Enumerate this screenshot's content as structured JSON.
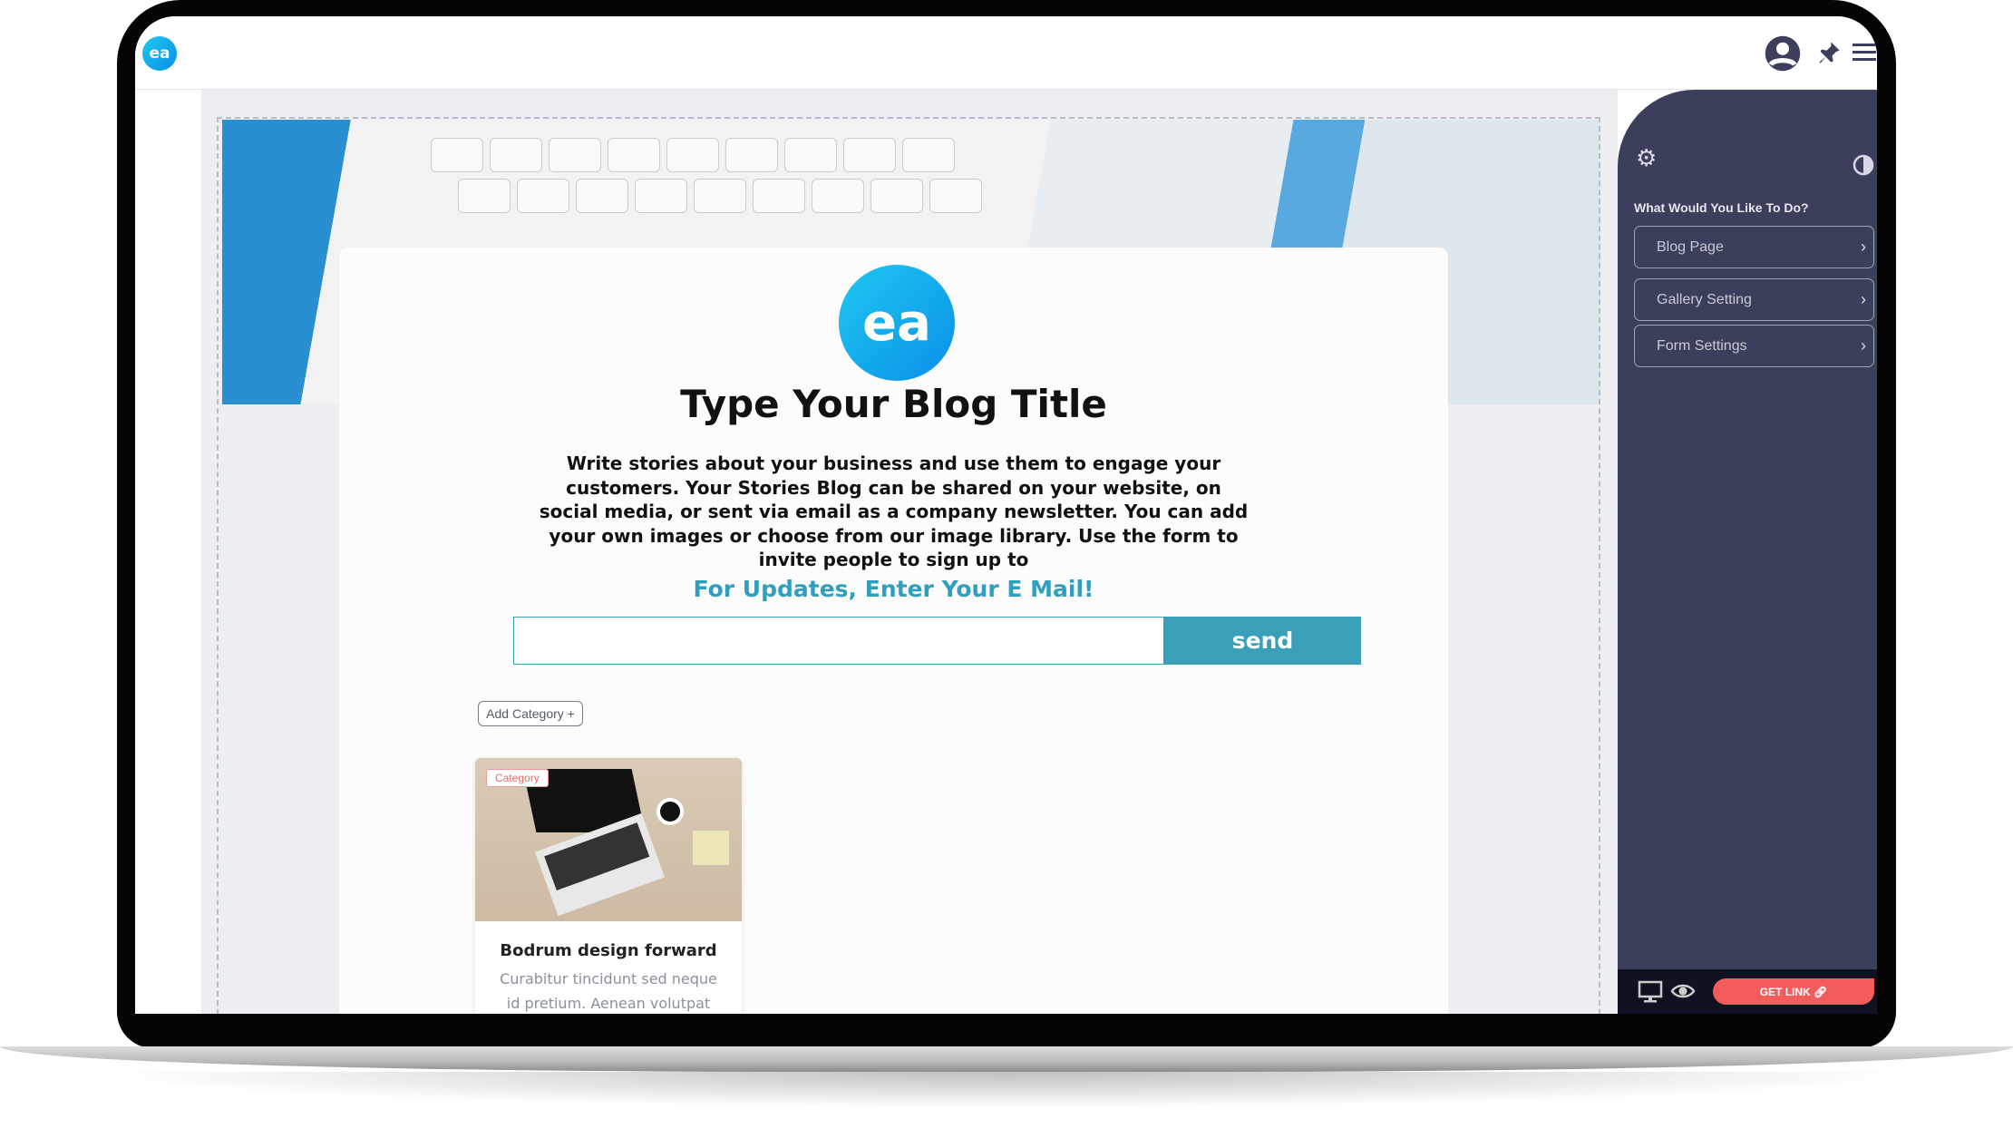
{
  "topbar": {
    "logo_text": "ea",
    "icons": [
      "user-circle-icon",
      "pin-icon",
      "menu-icon"
    ]
  },
  "card": {
    "logo_text": "ea",
    "title": "Type Your Blog Title",
    "paragraph": "Write stories about your business and use them to engage your customers. Your Stories Blog can be shared on your website, on social media, or sent via email as a company newsletter. You can add your own images or choose from our image library. Use the form to invite people to sign up to",
    "cta": "For Updates, Enter Your E Mail!",
    "email_value": "",
    "send_label": "send",
    "add_category_label": "Add Category +",
    "post": {
      "category": "Category",
      "title": "Bodrum design forward",
      "excerpt": "Curabitur tincidunt sed neque id pretium. Aenean volutpat"
    }
  },
  "sidebar": {
    "heading": "What Would You Like To Do?",
    "items": [
      {
        "label": "Blog Page"
      },
      {
        "label": "Gallery Setting"
      },
      {
        "label": "Form Settings"
      }
    ],
    "get_link_label": "GET LINK"
  },
  "colors": {
    "accent": "#3aa0b8",
    "sidebar": "#3b3f5c",
    "get_link": "#f25c5c"
  }
}
